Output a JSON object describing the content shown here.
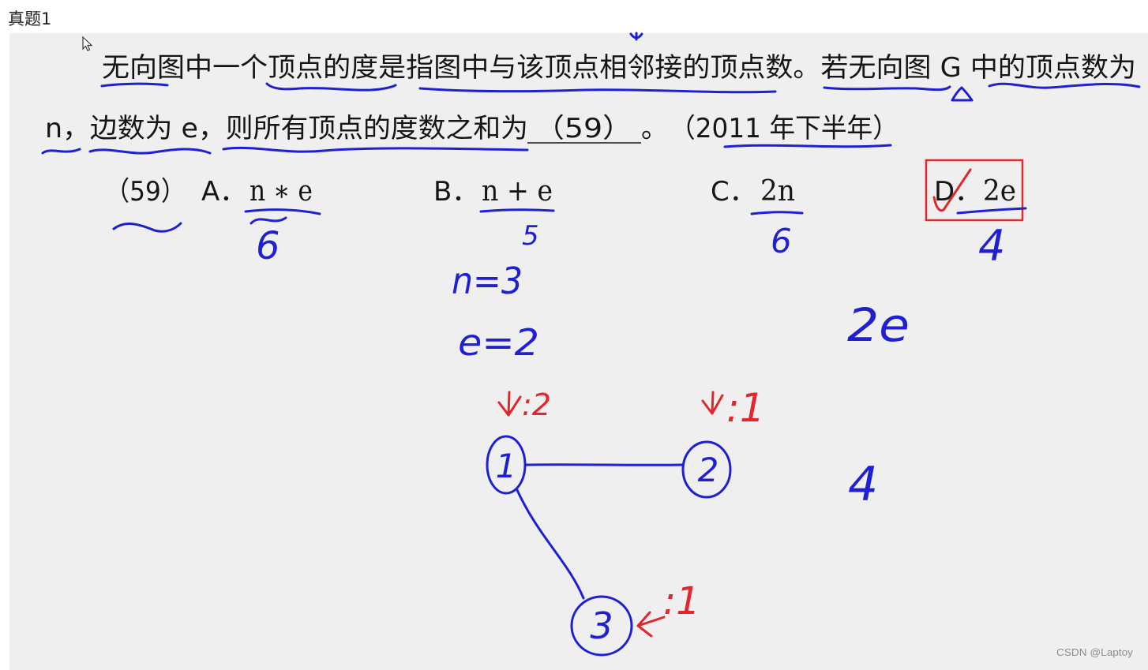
{
  "page": {
    "heading": "真题1"
  },
  "slide": {
    "question": {
      "line1": "无向图中一个顶点的度是指图中与该顶点相邻接的顶点数。若无向图 G 中的顶点数为",
      "line2_lead": "n，边数为 e，则所有顶点的度数之和为",
      "blank": "（59）",
      "line2_period": "。",
      "source": "（2011 年下半年）"
    },
    "options": {
      "label": "（59）",
      "items": [
        {
          "letter": "A．",
          "text": "n ∗ e",
          "marked_correct": false
        },
        {
          "letter": "B．",
          "text": "n + e",
          "marked_correct": false
        },
        {
          "letter": "C．",
          "text": "2n",
          "marked_correct": false
        },
        {
          "letter": "D．",
          "text": "2e",
          "marked_correct": true
        }
      ]
    },
    "annotations": {
      "option_results": [
        "6",
        "5",
        "6",
        "4"
      ],
      "n_value": "n=3",
      "e_value": "e=2",
      "formula": "2e",
      "result": "4",
      "graph": {
        "nodes": [
          {
            "label": "1",
            "degree": ":2"
          },
          {
            "label": "2",
            "degree": ":1"
          },
          {
            "label": "3",
            "degree": ":1"
          }
        ],
        "edges": [
          [
            1,
            2
          ],
          [
            1,
            3
          ]
        ]
      }
    },
    "watermark": "CSDN @Laptoy"
  },
  "icons": {
    "cursor": "cursor-icon",
    "answer_check": "check-mark-icon",
    "degree_arrows": [
      "arrow-down-icon",
      "arrow-down-icon",
      "arrow-left-icon"
    ]
  },
  "colors": {
    "annotation_blue": "#1f1fd4",
    "annotation_red": "#e3262c",
    "answer_box": "#e02a2f",
    "slide_background": "#efefef",
    "text": "#151515"
  }
}
